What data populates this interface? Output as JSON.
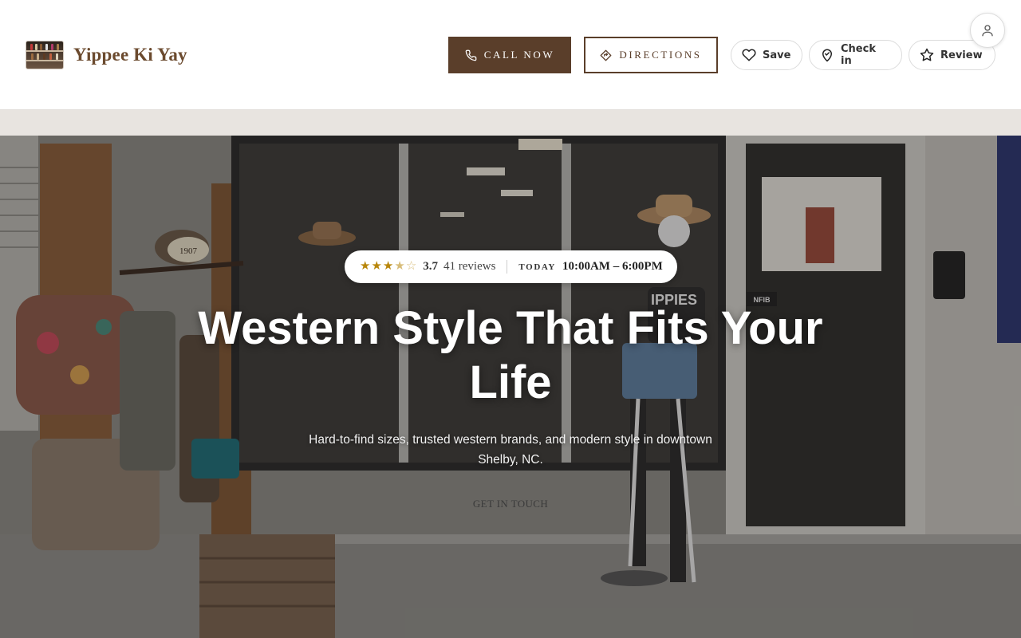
{
  "brand": {
    "name": "Yippee Ki Yay",
    "logo_icon": "storefront-photo-thumbnail"
  },
  "header": {
    "call_label": "CALL NOW",
    "directions_label": "DIRECTIONS",
    "save_label": "Save",
    "checkin_label": "Check in",
    "review_label": "Review"
  },
  "rating": {
    "stars_filled": 3,
    "stars_half": 1,
    "stars_total": 5,
    "score": "3.7",
    "reviews": "41 reviews",
    "today_label": "TODAY",
    "hours": "10:00AM – 6:00PM"
  },
  "hero": {
    "title": "Western Style That Fits Your Life",
    "subtitle": "Hard-to-find sizes, trusted western brands, and modern style in downtown Shelby, NC.",
    "cta": "GET IN TOUCH",
    "scene_text": [
      "1907",
      "IPPIES",
      "NFIB"
    ]
  },
  "colors": {
    "brand_brown": "#5a3e2a",
    "brand_name": "#6b4a2e",
    "star_gold": "#b8860b",
    "band": "#e8e4e0"
  }
}
